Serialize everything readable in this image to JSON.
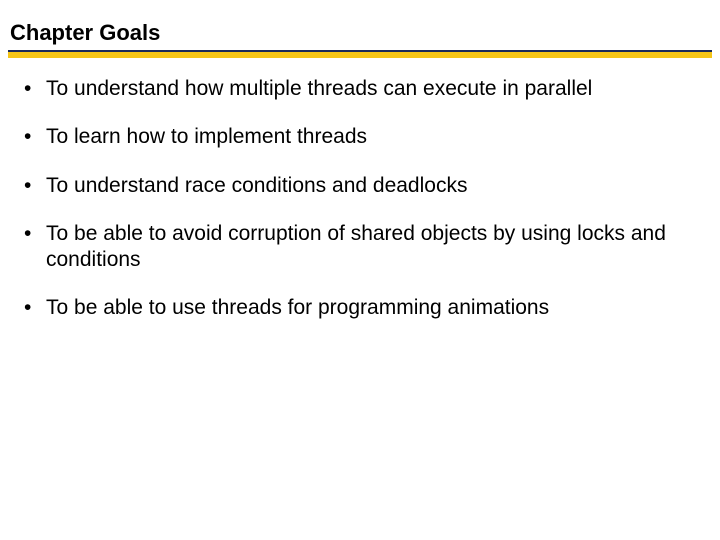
{
  "title": "Chapter Goals",
  "goals": [
    "To understand how multiple threads can execute in parallel",
    "To learn how to implement threads",
    "To understand race conditions and deadlocks",
    "To be able to avoid corruption of shared objects by using locks and conditions",
    "To be able to use threads for programming animations"
  ]
}
